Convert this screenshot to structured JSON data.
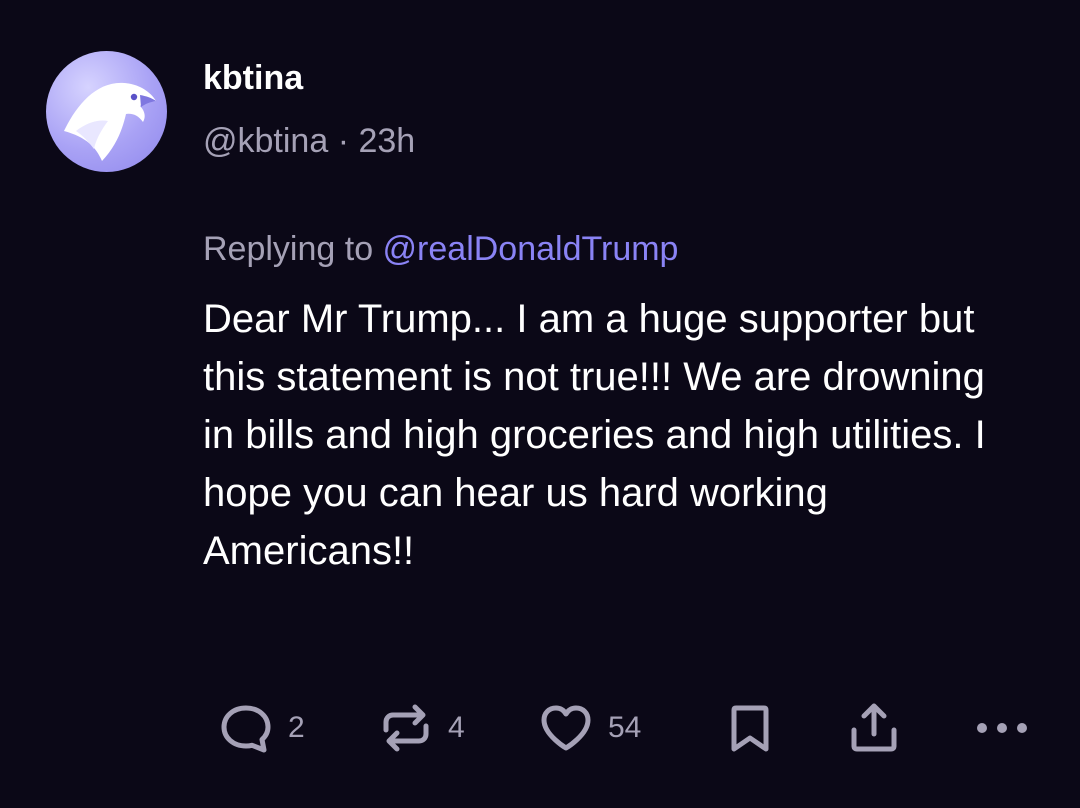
{
  "author": {
    "display_name": "kbtina",
    "handle": "@kbtina",
    "separator": " · ",
    "time_ago": "23h",
    "avatar_icon": "eagle-avatar-icon"
  },
  "reply": {
    "prefix": "Replying to ",
    "mention": "@realDonaldTrump"
  },
  "post": {
    "text": "Dear Mr Trump... I am a huge supporter but this statement is not true!!! We are drowning in bills and high groceries and high utilities. I hope you can hear us hard working Americans!!"
  },
  "actions": {
    "reply": {
      "icon": "comment-icon",
      "count": "2"
    },
    "repost": {
      "icon": "repost-icon",
      "count": "4"
    },
    "like": {
      "icon": "heart-icon",
      "count": "54"
    },
    "bookmark": {
      "icon": "bookmark-icon"
    },
    "share": {
      "icon": "share-icon"
    },
    "more": {
      "icon": "more-icon"
    }
  },
  "colors": {
    "background": "#0b0817",
    "text": "#ffffff",
    "muted": "#a5a1b6",
    "accent": "#8a83f5",
    "avatar": "#a9a2f5"
  }
}
